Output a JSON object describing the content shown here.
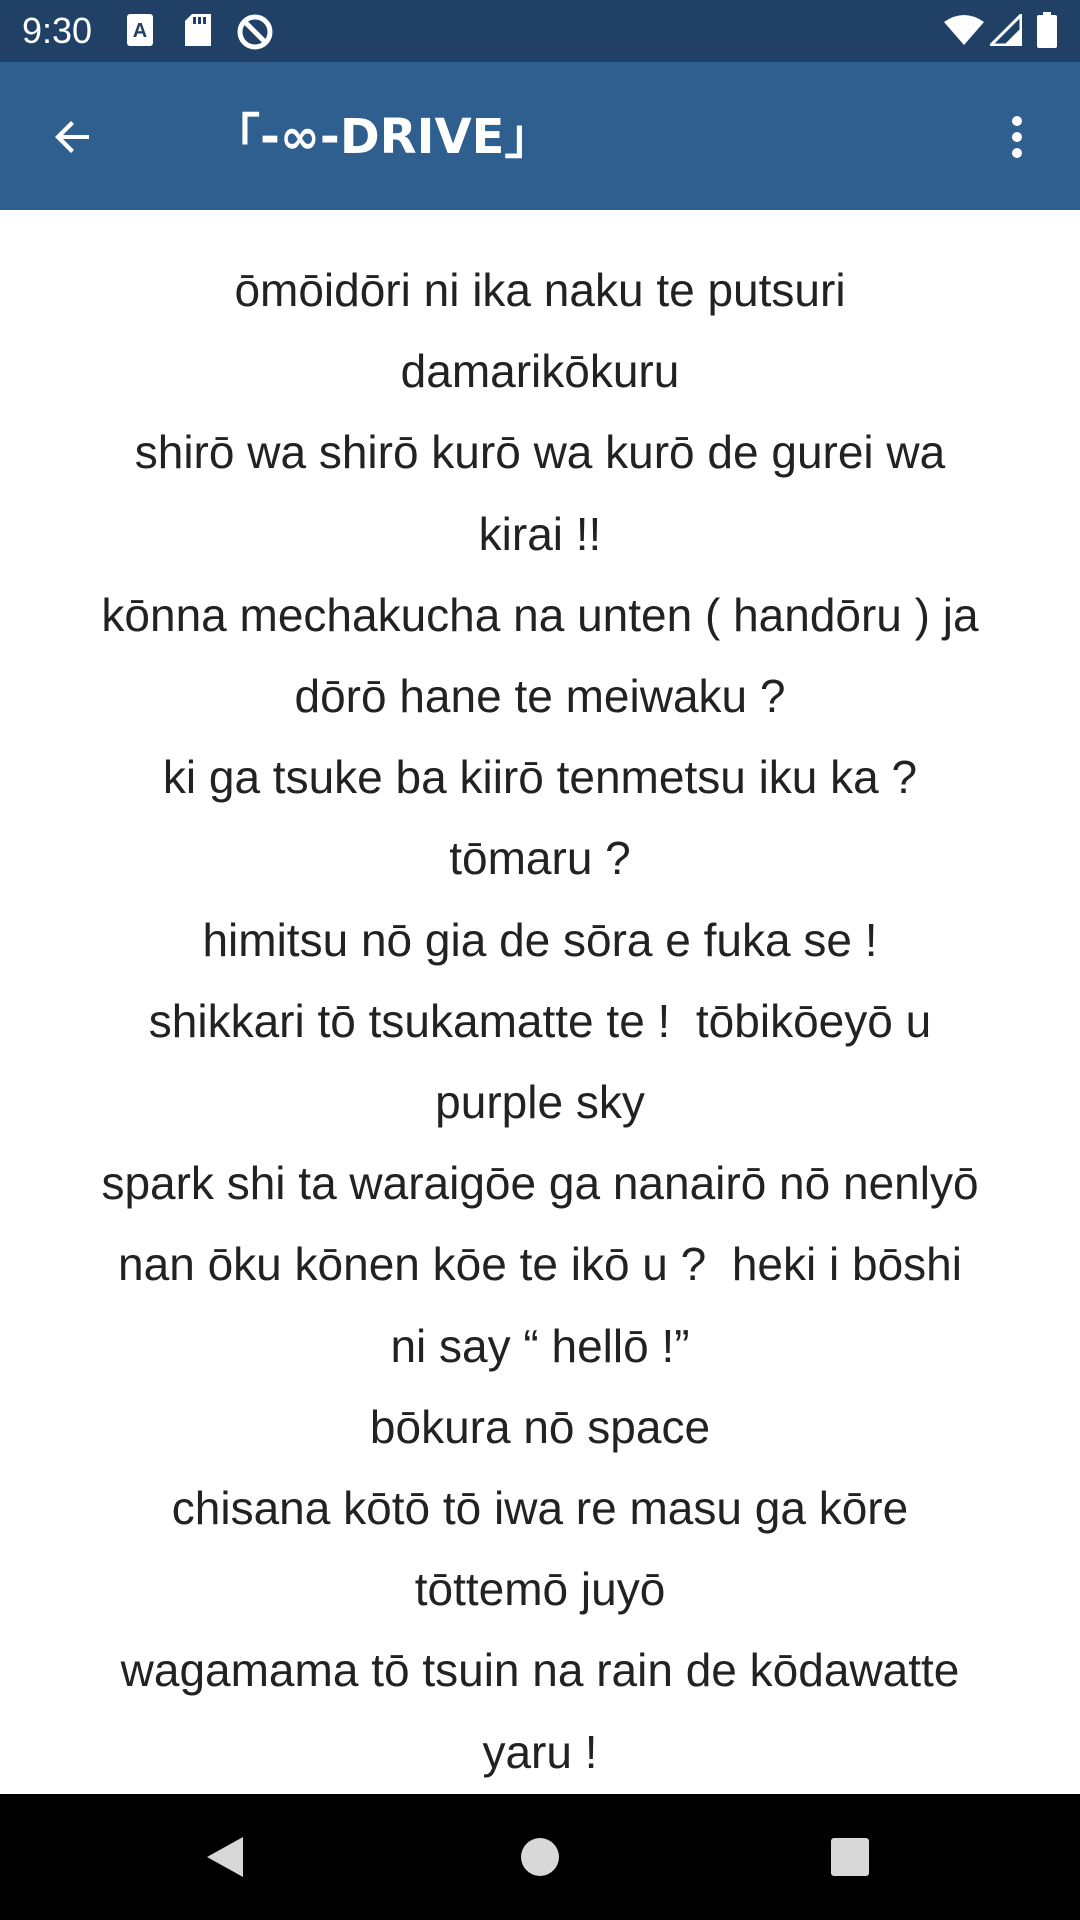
{
  "status_bar": {
    "time": "9:30",
    "left_icons": [
      "a-notification-icon",
      "sd-card-icon",
      "sync-icon"
    ],
    "right_icons": [
      "wifi-icon",
      "cell-signal-icon",
      "battery-icon"
    ]
  },
  "app_bar": {
    "title": "「-∞-DRIVE」",
    "back_icon": "arrow-back-icon",
    "menu_icon": "more-vert-icon",
    "background": "#2e5f8e"
  },
  "lyrics": {
    "lines": [
      "ōmōidōri ni ika naku te putsuri",
      "damarikōkuru",
      "shirō wa shirō kurō wa kurō de gurei wa",
      "kirai !!",
      "kōnna mechakucha na unten ( handōru ) ja",
      "dōrō hane te meiwaku ?",
      "ki ga tsuke ba kiirō tenmetsu iku ka ?",
      "tōmaru ?",
      "himitsu nō gia de sōra e fuka se !",
      "shikkari tō tsukamatte te !  tōbikōeyō u",
      "purple sky",
      "spark shi ta waraigōe ga nanairō nō nenlyō",
      "nan ōku kōnen kōe te ikō u ?  heki i bōshi",
      "ni say “ hellō !”",
      "bōkura nō space",
      "chisana kōtō tō iwa re masu ga kōre",
      "tōttemō juyō",
      "wagamama tō tsuin na rain de kōdawatte",
      "yaru !"
    ]
  },
  "nav_bar": {
    "icons": [
      "nav-back-icon",
      "nav-home-icon",
      "nav-recents-icon"
    ]
  }
}
